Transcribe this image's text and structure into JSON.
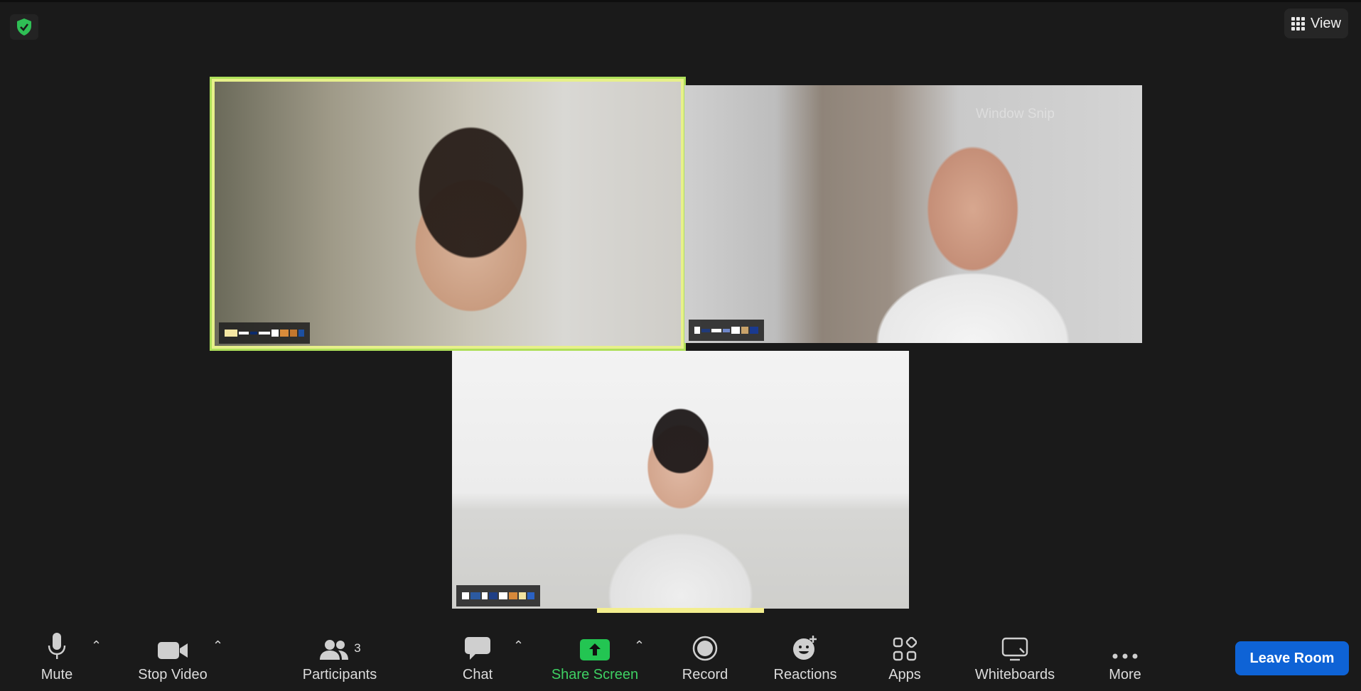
{
  "top": {
    "view_label": "View"
  },
  "watermark": "Window Snip",
  "participants_tiles": [
    {
      "tag_colors": [
        "#f5e7a3",
        "#ffffff",
        "#0b2a6b",
        "#ffffff",
        "#d98b3a",
        "#ffffff",
        "#c2772e",
        "#1c4fa0"
      ]
    },
    {
      "tag_colors": [
        "#ffffff",
        "#203a7a",
        "#ffffff",
        "#6f87c9",
        "#ffffff",
        "#c9a36a",
        "#1a3a90"
      ]
    },
    {
      "tag_colors": [
        "#ffffff",
        "#2c5aa0",
        "#ffffff",
        "#1f3f86",
        "#ffffff",
        "#d7893a",
        "#f2e3a0",
        "#2b62c4"
      ]
    }
  ],
  "toolbar": {
    "mute": "Mute",
    "stop_video": "Stop Video",
    "participants": "Participants",
    "participant_count": "3",
    "chat": "Chat",
    "share_screen": "Share Screen",
    "record": "Record",
    "reactions": "Reactions",
    "apps": "Apps",
    "whiteboards": "Whiteboards",
    "more": "More",
    "leave": "Leave Room"
  },
  "colors": {
    "background": "#1a1a1a",
    "share_green": "#3ed063",
    "leave_blue": "#0e63d6",
    "active_speaker_border": "#e7f08a"
  }
}
